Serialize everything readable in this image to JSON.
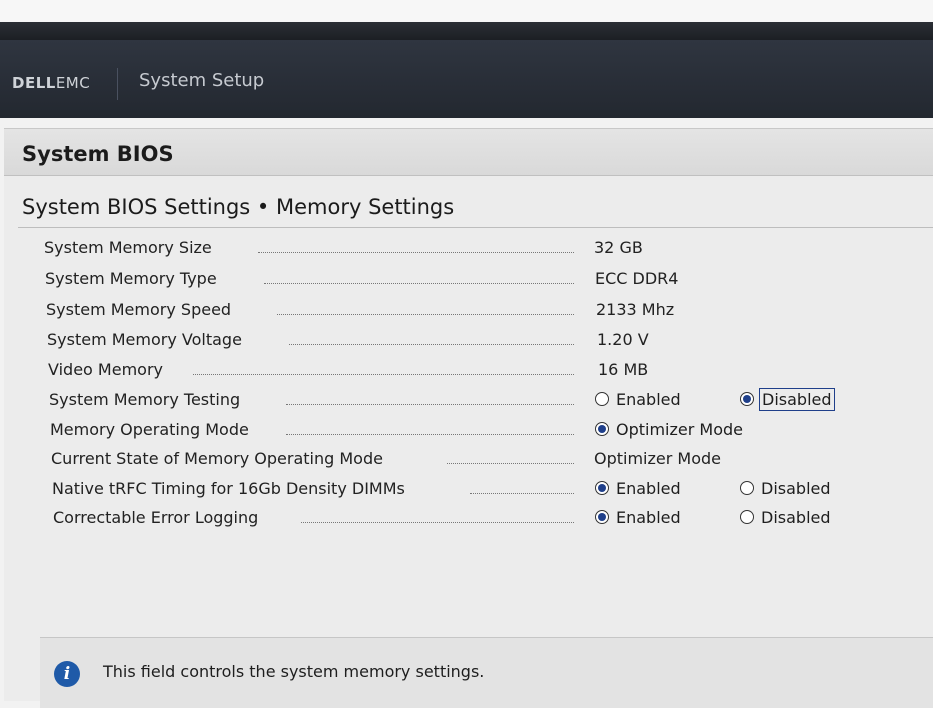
{
  "header": {
    "logo_bold": "D",
    "logo_mid": "ELL",
    "logo_rest": "EMC",
    "title": "System Setup"
  },
  "page": {
    "title": "System BIOS",
    "section_title": "System BIOS Settings • Memory Settings"
  },
  "rows": [
    {
      "label": "System Memory Size",
      "value": "32 GB"
    },
    {
      "label": "System Memory Type",
      "value": "ECC DDR4"
    },
    {
      "label": "System Memory Speed",
      "value": "2133 Mhz"
    },
    {
      "label": "System Memory Voltage",
      "value": "1.20 V"
    },
    {
      "label": "Video Memory",
      "value": "16 MB"
    },
    {
      "label": "System Memory Testing",
      "options": [
        "Enabled",
        "Disabled"
      ],
      "selected": "Disabled"
    },
    {
      "label": "Memory Operating Mode",
      "options": [
        "Optimizer Mode"
      ],
      "selected": "Optimizer Mode"
    },
    {
      "label": "Current State of Memory Operating Mode",
      "value": "Optimizer Mode"
    },
    {
      "label": "Native tRFC Timing for 16Gb Density DIMMs",
      "options": [
        "Enabled",
        "Disabled"
      ],
      "selected": "Enabled"
    },
    {
      "label": "Correctable Error Logging",
      "options": [
        "Enabled",
        "Disabled"
      ],
      "selected": "Enabled"
    }
  ],
  "help": {
    "icon": "info-icon",
    "text": "This field controls the system memory settings."
  },
  "colors": {
    "accent": "#1f3f8a",
    "header_bg": "#2a2f38",
    "info_blue": "#1f5aa8"
  }
}
